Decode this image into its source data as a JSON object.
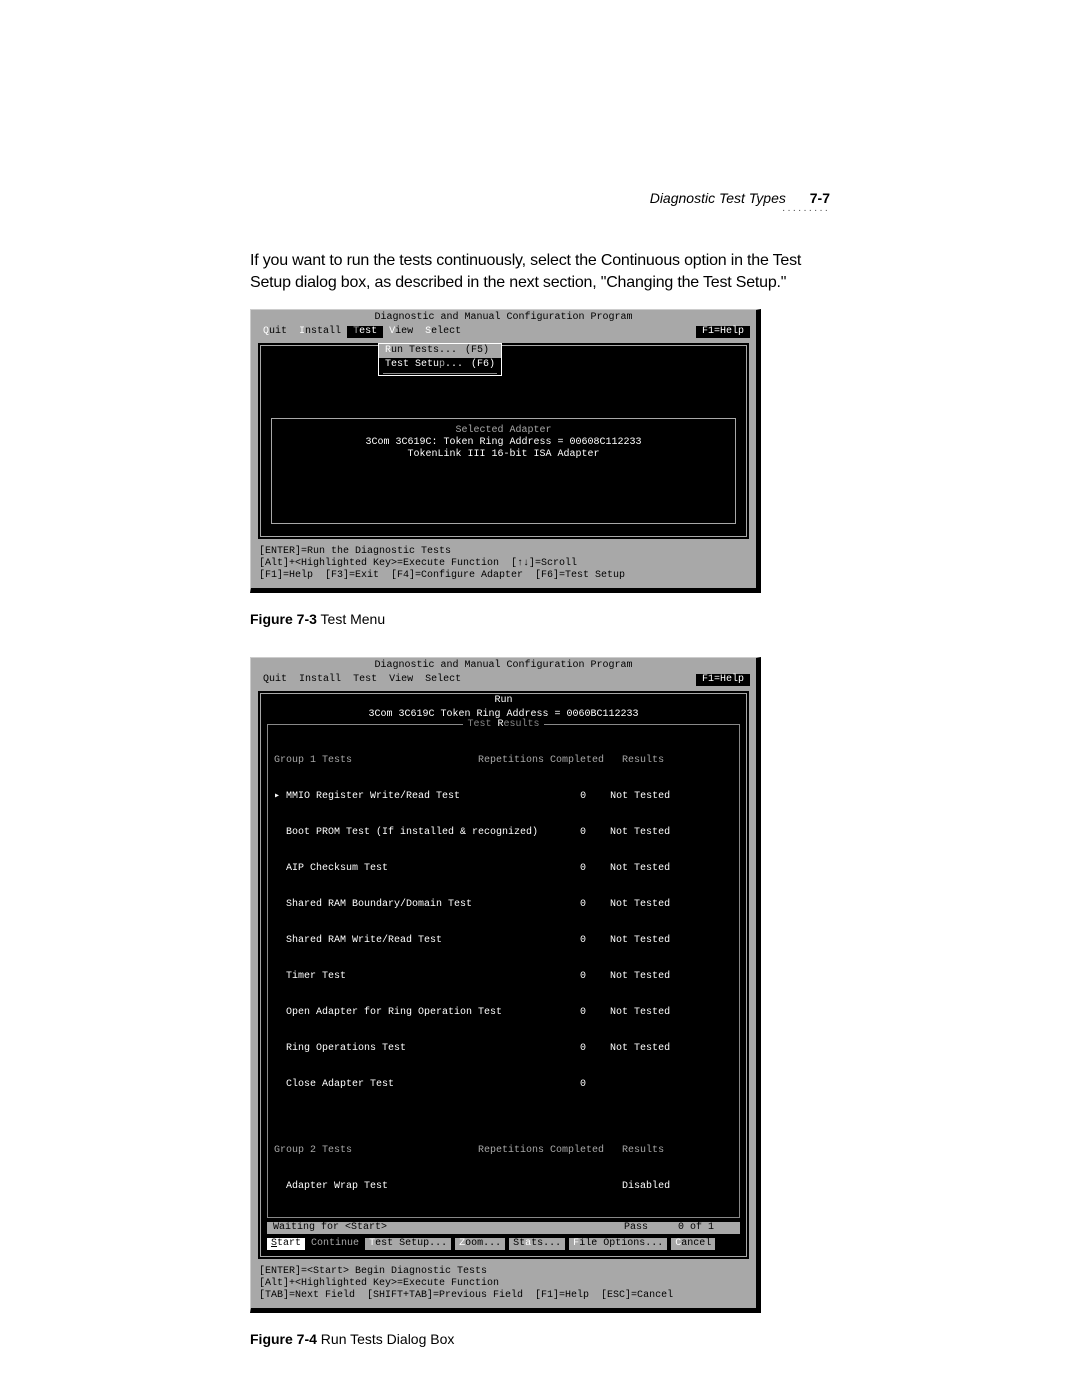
{
  "header": {
    "title": "Diagnostic Test Types",
    "page": "7-7",
    "dots": "·········"
  },
  "paragraph": "If you want to run the tests continuously, select the Continuous option in the Test Setup dialog box, as described in the next section, \"Changing the Test Setup.\"",
  "fig1": {
    "caption_bold": "Figure 7-3",
    "caption_rest": "  Test Menu",
    "program_title": "Diagnostic and Manual Configuration Program",
    "menubar": {
      "quit": {
        "hot": "Q",
        "rest": "uit"
      },
      "install": {
        "hot": "I",
        "rest": "nstall"
      },
      "test": {
        "hot": "T",
        "rest": "est"
      },
      "view": {
        "hot": "V",
        "rest": "iew"
      },
      "select": {
        "hot": "S",
        "rest": "elect"
      },
      "help": "F1=Help"
    },
    "dropdown": {
      "run": {
        "hot": "R",
        "label": "un Tests...",
        "key": "(F5)"
      },
      "setup": {
        "hot": "p",
        "label_pre": "Test Setu",
        "label_post": "...",
        "key": "(F6)"
      }
    },
    "adapter": {
      "label": "Selected Adapter",
      "line1": "3Com 3C619C: Token Ring Address = 00608C112233",
      "line2": "TokenLink III 16-bit ISA Adapter"
    },
    "status": "[ENTER]=Run the Diagnostic Tests\n[Alt]+<Highlighted Key>=Execute Function  [↑↓]=Scroll\n[F1]=Help  [F3]=Exit  [F4]=Configure Adapter  [F6]=Test Setup"
  },
  "fig2": {
    "caption_bold": "Figure 7-4",
    "caption_rest": "  Run Tests Dialog Box",
    "program_title": "Diagnostic and Manual Configuration Program",
    "menubar": {
      "quit": {
        "hot": "Q",
        "rest": "uit"
      },
      "install": {
        "hot": "I",
        "rest": "nstall"
      },
      "test": {
        "hot": "T",
        "rest": "est"
      },
      "view": {
        "hot": "V",
        "rest": "iew"
      },
      "select": {
        "hot": "S",
        "rest": "elect"
      },
      "help": "F1=Help"
    },
    "run_header": "Run",
    "addr_line": "3Com 3C619C Token Ring Address = 0060BC112233",
    "results_label": "Test Results",
    "cols": "Group 1 Tests                     Repetitions Completed   Results",
    "rows": [
      "▸ MMIO Register Write/Read Test                    0    Not Tested",
      "  Boot PROM Test (If installed & recognized)       0    Not Tested",
      "  AIP Checksum Test                                0    Not Tested",
      "  Shared RAM Boundary/Domain Test                  0    Not Tested",
      "  Shared RAM Write/Read Test                       0    Not Tested",
      "  Timer Test                                       0    Not Tested",
      "  Open Adapter for Ring Operation Test             0    Not Tested",
      "  Ring Operations Test                             0    Not Tested",
      "  Close Adapter Test                               0"
    ],
    "group2_hdr": "Group 2 Tests                     Repetitions Completed   Results",
    "group2_row": "  Adapter Wrap Test                                       Disabled",
    "wait": {
      "label": "Waiting for <Start>",
      "pass": "Pass",
      "count": "0  of  1"
    },
    "actions": {
      "start": {
        "hot": "S",
        "rest": "tart"
      },
      "continue": {
        "hot": "C",
        "rest": "ontinue"
      },
      "testsetup": {
        "hot": "T",
        "rest": "est Setup..."
      },
      "zoom": {
        "hot": "Z",
        "rest": "oom..."
      },
      "stats": {
        "pre": "St",
        "hot": "a",
        "rest": "ts..."
      },
      "file": {
        "hot": "F",
        "rest": "ile Options..."
      },
      "cancel": {
        "hot": "C",
        "rest": "ancel"
      }
    },
    "status": "[ENTER]=<Start> Begin Diagnostic Tests\n[Alt]+<Highlighted Key>=Execute Function\n[TAB]=Next Field  [SHIFT+TAB]=Previous Field  [F1]=Help  [ESC]=Cancel"
  }
}
